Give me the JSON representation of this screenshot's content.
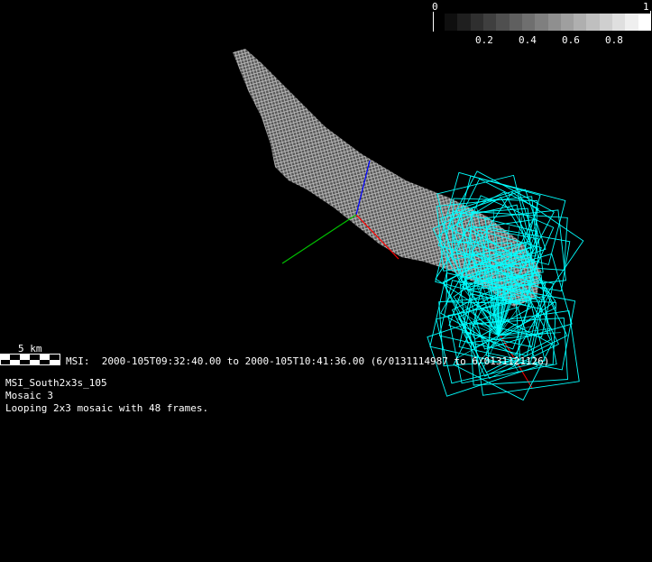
{
  "colorbar": {
    "min_label": "0",
    "max_label": "1",
    "tick_labels": [
      "0.2",
      "0.4",
      "0.6",
      "0.8"
    ],
    "steps": 16,
    "colormap": "grayscale"
  },
  "scale_bar": {
    "label": "5 km"
  },
  "info": {
    "time_range": "MSI:  2000-105T09:32:40.00 to 2000-105T10:41:36.00 (6/0131114987 to 6/0131121126)",
    "mosaic_name": "MSI_South2x3s_105",
    "mosaic_number": "Mosaic 3",
    "description": "Looping 2x3 mosaic with 48 frames."
  },
  "colors": {
    "frame_outline": "#00ffff",
    "axis_x": "#ff0000",
    "axis_y": "#00c000",
    "axis_z": "#0000ff",
    "shape": "#b0b0b0"
  }
}
